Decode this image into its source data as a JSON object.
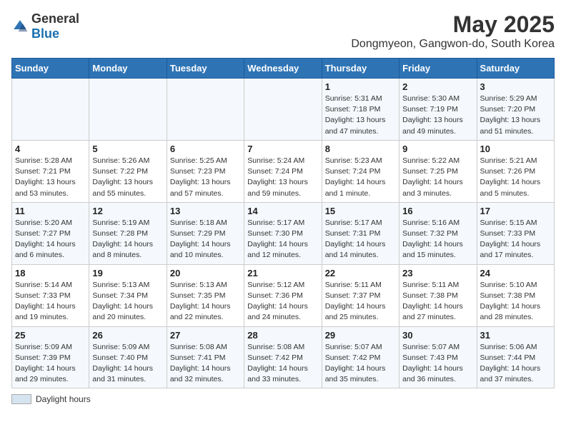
{
  "header": {
    "logo_general": "General",
    "logo_blue": "Blue",
    "title": "May 2025",
    "subtitle": "Dongmyeon, Gangwon-do, South Korea"
  },
  "weekdays": [
    "Sunday",
    "Monday",
    "Tuesday",
    "Wednesday",
    "Thursday",
    "Friday",
    "Saturday"
  ],
  "weeks": [
    [
      {
        "num": "",
        "info": ""
      },
      {
        "num": "",
        "info": ""
      },
      {
        "num": "",
        "info": ""
      },
      {
        "num": "",
        "info": ""
      },
      {
        "num": "1",
        "info": "Sunrise: 5:31 AM\nSunset: 7:18 PM\nDaylight: 13 hours\nand 47 minutes."
      },
      {
        "num": "2",
        "info": "Sunrise: 5:30 AM\nSunset: 7:19 PM\nDaylight: 13 hours\nand 49 minutes."
      },
      {
        "num": "3",
        "info": "Sunrise: 5:29 AM\nSunset: 7:20 PM\nDaylight: 13 hours\nand 51 minutes."
      }
    ],
    [
      {
        "num": "4",
        "info": "Sunrise: 5:28 AM\nSunset: 7:21 PM\nDaylight: 13 hours\nand 53 minutes."
      },
      {
        "num": "5",
        "info": "Sunrise: 5:26 AM\nSunset: 7:22 PM\nDaylight: 13 hours\nand 55 minutes."
      },
      {
        "num": "6",
        "info": "Sunrise: 5:25 AM\nSunset: 7:23 PM\nDaylight: 13 hours\nand 57 minutes."
      },
      {
        "num": "7",
        "info": "Sunrise: 5:24 AM\nSunset: 7:24 PM\nDaylight: 13 hours\nand 59 minutes."
      },
      {
        "num": "8",
        "info": "Sunrise: 5:23 AM\nSunset: 7:24 PM\nDaylight: 14 hours\nand 1 minute."
      },
      {
        "num": "9",
        "info": "Sunrise: 5:22 AM\nSunset: 7:25 PM\nDaylight: 14 hours\nand 3 minutes."
      },
      {
        "num": "10",
        "info": "Sunrise: 5:21 AM\nSunset: 7:26 PM\nDaylight: 14 hours\nand 5 minutes."
      }
    ],
    [
      {
        "num": "11",
        "info": "Sunrise: 5:20 AM\nSunset: 7:27 PM\nDaylight: 14 hours\nand 6 minutes."
      },
      {
        "num": "12",
        "info": "Sunrise: 5:19 AM\nSunset: 7:28 PM\nDaylight: 14 hours\nand 8 minutes."
      },
      {
        "num": "13",
        "info": "Sunrise: 5:18 AM\nSunset: 7:29 PM\nDaylight: 14 hours\nand 10 minutes."
      },
      {
        "num": "14",
        "info": "Sunrise: 5:17 AM\nSunset: 7:30 PM\nDaylight: 14 hours\nand 12 minutes."
      },
      {
        "num": "15",
        "info": "Sunrise: 5:17 AM\nSunset: 7:31 PM\nDaylight: 14 hours\nand 14 minutes."
      },
      {
        "num": "16",
        "info": "Sunrise: 5:16 AM\nSunset: 7:32 PM\nDaylight: 14 hours\nand 15 minutes."
      },
      {
        "num": "17",
        "info": "Sunrise: 5:15 AM\nSunset: 7:33 PM\nDaylight: 14 hours\nand 17 minutes."
      }
    ],
    [
      {
        "num": "18",
        "info": "Sunrise: 5:14 AM\nSunset: 7:33 PM\nDaylight: 14 hours\nand 19 minutes."
      },
      {
        "num": "19",
        "info": "Sunrise: 5:13 AM\nSunset: 7:34 PM\nDaylight: 14 hours\nand 20 minutes."
      },
      {
        "num": "20",
        "info": "Sunrise: 5:13 AM\nSunset: 7:35 PM\nDaylight: 14 hours\nand 22 minutes."
      },
      {
        "num": "21",
        "info": "Sunrise: 5:12 AM\nSunset: 7:36 PM\nDaylight: 14 hours\nand 24 minutes."
      },
      {
        "num": "22",
        "info": "Sunrise: 5:11 AM\nSunset: 7:37 PM\nDaylight: 14 hours\nand 25 minutes."
      },
      {
        "num": "23",
        "info": "Sunrise: 5:11 AM\nSunset: 7:38 PM\nDaylight: 14 hours\nand 27 minutes."
      },
      {
        "num": "24",
        "info": "Sunrise: 5:10 AM\nSunset: 7:38 PM\nDaylight: 14 hours\nand 28 minutes."
      }
    ],
    [
      {
        "num": "25",
        "info": "Sunrise: 5:09 AM\nSunset: 7:39 PM\nDaylight: 14 hours\nand 29 minutes."
      },
      {
        "num": "26",
        "info": "Sunrise: 5:09 AM\nSunset: 7:40 PM\nDaylight: 14 hours\nand 31 minutes."
      },
      {
        "num": "27",
        "info": "Sunrise: 5:08 AM\nSunset: 7:41 PM\nDaylight: 14 hours\nand 32 minutes."
      },
      {
        "num": "28",
        "info": "Sunrise: 5:08 AM\nSunset: 7:42 PM\nDaylight: 14 hours\nand 33 minutes."
      },
      {
        "num": "29",
        "info": "Sunrise: 5:07 AM\nSunset: 7:42 PM\nDaylight: 14 hours\nand 35 minutes."
      },
      {
        "num": "30",
        "info": "Sunrise: 5:07 AM\nSunset: 7:43 PM\nDaylight: 14 hours\nand 36 minutes."
      },
      {
        "num": "31",
        "info": "Sunrise: 5:06 AM\nSunset: 7:44 PM\nDaylight: 14 hours\nand 37 minutes."
      }
    ]
  ],
  "legend": {
    "label": "Daylight hours"
  }
}
